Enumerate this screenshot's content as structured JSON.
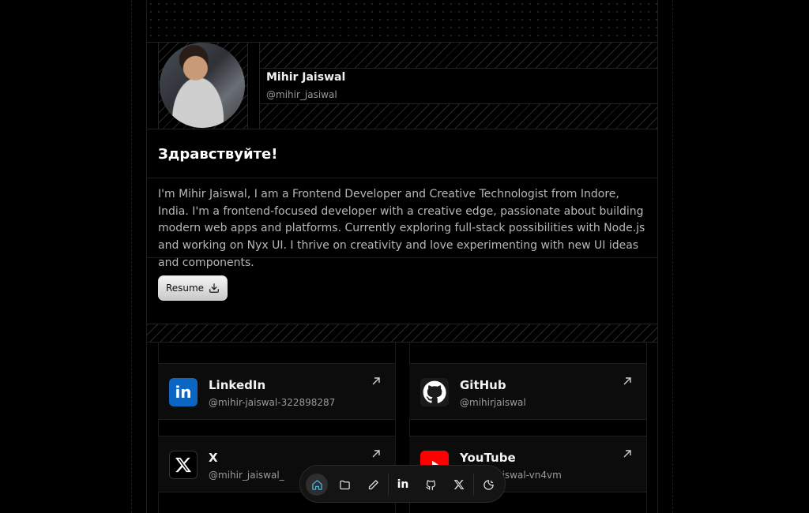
{
  "profile": {
    "name": "Mihir Jaiswal",
    "handle": "@mihir_jasiwal"
  },
  "greeting": "Здравствуйте!",
  "bio": "I'm Mihir Jaiswal, I am a Frontend Developer and Creative Technologist from Indore, India. I'm a frontend-focused developer with a creative edge, passionate about building modern web apps and platforms. Currently exploring full-stack possibilities with Node.js and working on Nyx UI. I thrive on creativity and love experimenting with new UI ideas and components.",
  "resume": {
    "label": "Resume",
    "icon": "download-icon"
  },
  "socials": [
    {
      "name": "LinkedIn",
      "handle": "@mihir-jaiswal-322898287",
      "icon": "linkedin-icon",
      "color": "#0a66c2"
    },
    {
      "name": "GitHub",
      "handle": "@mihirjaiswal",
      "icon": "github-icon",
      "color": "#ffffff"
    },
    {
      "name": "X",
      "handle": "@mihir_jaiswal_",
      "icon": "x-icon",
      "color": "#000000"
    },
    {
      "name": "YouTube",
      "handle": "@mihirjaiswal-vn4vm",
      "icon": "youtube-icon",
      "color": "#ff0000"
    }
  ],
  "dock": [
    {
      "icon": "home-icon",
      "active": true
    },
    {
      "icon": "folder-icon"
    },
    {
      "icon": "pencil-icon"
    },
    {
      "icon": "linkedin-icon"
    },
    {
      "icon": "github-icon"
    },
    {
      "icon": "x-icon"
    },
    {
      "icon": "theme-toggle-icon"
    }
  ],
  "colors": {
    "background": "#000000",
    "accent": "#38bdf8"
  }
}
